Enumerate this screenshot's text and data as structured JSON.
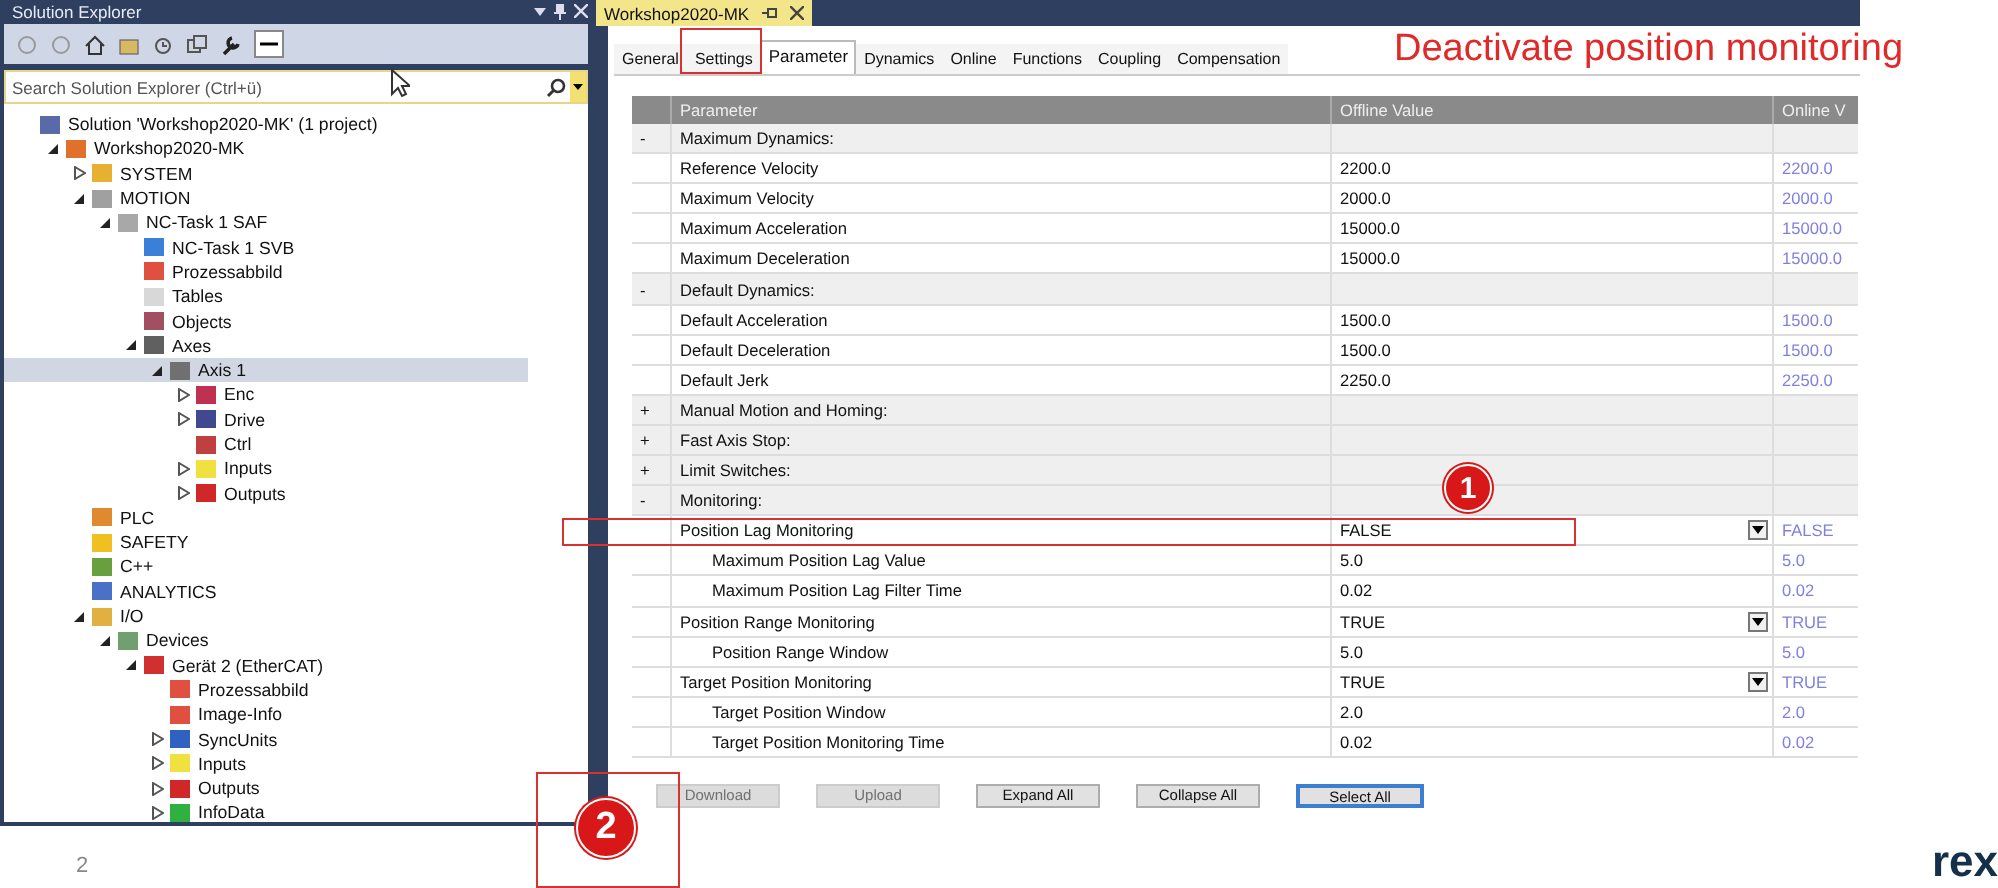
{
  "solution_explorer": {
    "title": "Solution Explorer",
    "search": {
      "placeholder": "Search Solution Explorer (Ctrl+ü)"
    },
    "tree": [
      {
        "label": "Solution 'Workshop2020-MK' (1 project)",
        "color": "#5a6aa8",
        "selected": false,
        "children": [
          {
            "label": "Workshop2020-MK",
            "color": "#e0702a",
            "expanded": true,
            "selected": false,
            "children": [
              {
                "label": "SYSTEM",
                "color": "#e8b030",
                "expanded": false,
                "selected": false
              },
              {
                "label": "MOTION",
                "color": "#a0a0a0",
                "expanded": true,
                "selected": false,
                "children": [
                  {
                    "label": "NC-Task 1 SAF",
                    "color": "#a8a8a8",
                    "expanded": true,
                    "selected": false,
                    "children": [
                      {
                        "label": "NC-Task 1 SVB",
                        "color": "#3a80d8",
                        "selected": false
                      },
                      {
                        "label": "Prozessabbild",
                        "color": "#e05040",
                        "selected": false
                      },
                      {
                        "label": "Tables",
                        "color": "#d8d8d8",
                        "selected": false
                      },
                      {
                        "label": "Objects",
                        "color": "#a05060",
                        "selected": false
                      },
                      {
                        "label": "Axes",
                        "color": "#606060",
                        "expanded": true,
                        "selected": false,
                        "children": [
                          {
                            "label": "Axis 1",
                            "color": "#707070",
                            "expanded": true,
                            "selected": true,
                            "children": [
                              {
                                "label": "Enc",
                                "color": "#c03050",
                                "expanded": false,
                                "selected": false
                              },
                              {
                                "label": "Drive",
                                "color": "#404890",
                                "expanded": false,
                                "selected": false
                              },
                              {
                                "label": "Ctrl",
                                "color": "#c04040",
                                "selected": false
                              },
                              {
                                "label": "Inputs",
                                "color": "#f0e040",
                                "expanded": false,
                                "selected": false
                              },
                              {
                                "label": "Outputs",
                                "color": "#d02828",
                                "expanded": false,
                                "selected": false
                              }
                            ]
                          }
                        ]
                      }
                    ]
                  }
                ]
              },
              {
                "label": "PLC",
                "color": "#e08a30",
                "selected": false
              },
              {
                "label": "SAFETY",
                "color": "#f0c020",
                "selected": false
              },
              {
                "label": "C++",
                "color": "#68a040",
                "selected": false
              },
              {
                "label": "ANALYTICS",
                "color": "#4a70c8",
                "selected": false
              },
              {
                "label": "I/O",
                "color": "#e0b040",
                "expanded": true,
                "selected": false,
                "children": [
                  {
                    "label": "Devices",
                    "color": "#70a070",
                    "expanded": true,
                    "selected": false,
                    "children": [
                      {
                        "label": "Gerät 2 (EtherCAT)",
                        "color": "#d03030",
                        "expanded": true,
                        "selected": false,
                        "children": [
                          {
                            "label": "Prozessabbild",
                            "color": "#e05040",
                            "selected": false
                          },
                          {
                            "label": "Image-Info",
                            "color": "#e05040",
                            "selected": false
                          },
                          {
                            "label": "SyncUnits",
                            "color": "#3060c0",
                            "expanded": false,
                            "selected": false
                          },
                          {
                            "label": "Inputs",
                            "color": "#f0e040",
                            "expanded": false,
                            "selected": false
                          },
                          {
                            "label": "Outputs",
                            "color": "#d02828",
                            "expanded": false,
                            "selected": false
                          },
                          {
                            "label": "InfoData",
                            "color": "#30b040",
                            "expanded": false,
                            "selected": false
                          }
                        ]
                      }
                    ]
                  }
                ]
              }
            ]
          }
        ]
      }
    ]
  },
  "document": {
    "tab": "Workshop2020-MK",
    "tabs": [
      {
        "label": "General",
        "selected": false
      },
      {
        "label": "Settings",
        "selected": false
      },
      {
        "label": "Parameter",
        "selected": true
      },
      {
        "label": "Dynamics",
        "selected": false
      },
      {
        "label": "Online",
        "selected": false
      },
      {
        "label": "Functions",
        "selected": false
      },
      {
        "label": "Coupling",
        "selected": false
      },
      {
        "label": "Compensation",
        "selected": false
      }
    ],
    "table": {
      "columns": [
        "Parameter",
        "Offline Value",
        "Online V"
      ],
      "rows": [
        {
          "kind": "group",
          "toggle": "-",
          "name": "Maximum Dynamics:"
        },
        {
          "kind": "param",
          "name": "Reference Velocity",
          "offline": "2200.0",
          "online": "2200.0"
        },
        {
          "kind": "param",
          "name": "Maximum Velocity",
          "offline": "2000.0",
          "online": "2000.0"
        },
        {
          "kind": "param",
          "name": "Maximum Acceleration",
          "offline": "15000.0",
          "online": "15000.0"
        },
        {
          "kind": "param",
          "name": "Maximum Deceleration",
          "offline": "15000.0",
          "online": "15000.0"
        },
        {
          "kind": "group",
          "toggle": "-",
          "name": "Default Dynamics:"
        },
        {
          "kind": "param",
          "name": "Default Acceleration",
          "offline": "1500.0",
          "online": "1500.0"
        },
        {
          "kind": "param",
          "name": "Default Deceleration",
          "offline": "1500.0",
          "online": "1500.0"
        },
        {
          "kind": "param",
          "name": "Default Jerk",
          "offline": "2250.0",
          "online": "2250.0"
        },
        {
          "kind": "group",
          "toggle": "+",
          "name": "Manual Motion and Homing:"
        },
        {
          "kind": "group",
          "toggle": "+",
          "name": "Fast Axis Stop:"
        },
        {
          "kind": "group",
          "toggle": "+",
          "name": "Limit Switches:"
        },
        {
          "kind": "group",
          "toggle": "-",
          "name": "Monitoring:"
        },
        {
          "kind": "param",
          "name": "Position Lag Monitoring",
          "offline": "FALSE",
          "online": "FALSE",
          "dropdown": true,
          "children": [
            {
              "kind": "param",
              "name": "Maximum Position Lag Value",
              "offline": "5.0",
              "online": "5.0"
            },
            {
              "kind": "param",
              "name": "Maximum Position Lag Filter Time",
              "offline": "0.02",
              "online": "0.02"
            }
          ]
        },
        {
          "kind": "param",
          "name": "Position Range Monitoring",
          "offline": "TRUE",
          "online": "TRUE",
          "dropdown": true,
          "children": [
            {
              "kind": "param",
              "name": "Position Range Window",
              "offline": "5.0",
              "online": "5.0"
            }
          ]
        },
        {
          "kind": "param",
          "name": "Target Position Monitoring",
          "offline": "TRUE",
          "online": "TRUE",
          "dropdown": true,
          "children": [
            {
              "kind": "param",
              "name": "Target Position Window",
              "offline": "2.0",
              "online": "2.0"
            },
            {
              "kind": "param",
              "name": "Target Position Monitoring Time",
              "offline": "0.02",
              "online": "0.02"
            }
          ]
        }
      ]
    },
    "buttons": [
      {
        "label": "Download",
        "disabled": true,
        "focused": false
      },
      {
        "label": "Upload",
        "disabled": true,
        "focused": false
      },
      {
        "label": "Expand All",
        "disabled": false,
        "focused": false
      },
      {
        "label": "Collapse All",
        "disabled": false,
        "focused": false
      },
      {
        "label": "Select All",
        "disabled": false,
        "focused": true
      }
    ]
  },
  "annotations": {
    "heading": "Deactivate position monitoring",
    "markers": [
      "1",
      "2"
    ]
  },
  "slide": {
    "page_number": "2",
    "logo": "rex"
  }
}
